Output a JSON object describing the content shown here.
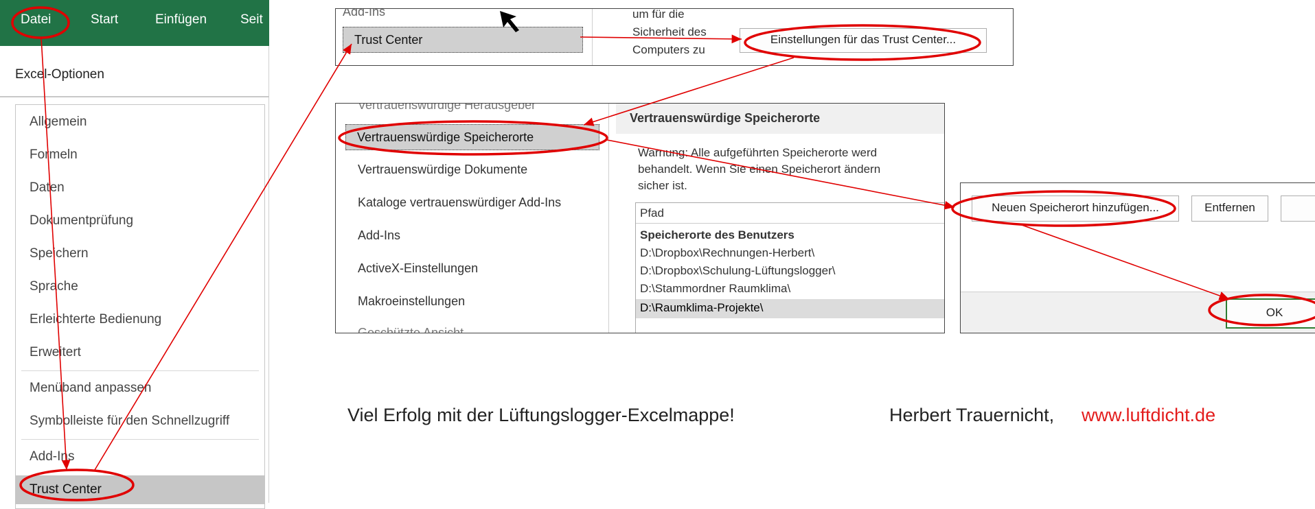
{
  "ribbon": {
    "tabs": [
      "Datei",
      "Start",
      "Einfügen",
      "Seit"
    ],
    "color": "#217346"
  },
  "excel_options": {
    "title": "Excel-Optionen",
    "items": [
      "Allgemein",
      "Formeln",
      "Daten",
      "Dokumentprüfung",
      "Speichern",
      "Sprache",
      "Erleichterte Bedienung",
      "Erweitert",
      "Menüband anpassen",
      "Symbolleiste für den Schnellzugriff",
      "Add-Ins",
      "Trust Center"
    ],
    "selected": "Trust Center"
  },
  "trust_panel": {
    "nav_top_partial": "Add-Ins",
    "nav_selected": "Trust Center",
    "desc_lines": [
      "um für die",
      "Sicherheit des",
      "Computers zu"
    ],
    "settings_button": "Einstellungen für das Trust Center..."
  },
  "locations_panel": {
    "nav_items": [
      "Vertrauenswürdige Herausgeber",
      "Vertrauenswürdige Speicherorte",
      "Vertrauenswürdige Dokumente",
      "Kataloge vertrauenswürdiger Add-Ins",
      "Add-Ins",
      "ActiveX-Einstellungen",
      "Makroeinstellungen",
      "Geschützte Ansicht"
    ],
    "heading": "Vertrauenswürdige Speicherorte",
    "warning_lines": [
      "Warnung: Alle aufgeführten Speicherorte werd",
      "behandelt. Wenn Sie einen Speicherort ändern",
      "sicher ist."
    ],
    "column_header": "Pfad",
    "group_header": "Speicherorte des Benutzers",
    "paths": [
      "D:\\Dropbox\\Rechnungen-Herbert\\",
      "D:\\Dropbox\\Schulung-Lüftungslogger\\",
      "D:\\Stammordner Raumklima\\",
      "D:\\Raumklima-Projekte\\"
    ]
  },
  "add_panel": {
    "add_button": "Neuen Speicherort hinzufügen...",
    "remove_button": "Entfernen",
    "ok_button": "OK"
  },
  "footer": {
    "message": "Viel Erfolg mit der Lüftungslogger-Excelmappe!",
    "author": "Herbert Trauernicht,",
    "website": "www.luftdicht.de"
  },
  "colors": {
    "annotation_red": "#e00000",
    "website_red": "#e31c1c",
    "ok_border": "#2e7d32"
  }
}
